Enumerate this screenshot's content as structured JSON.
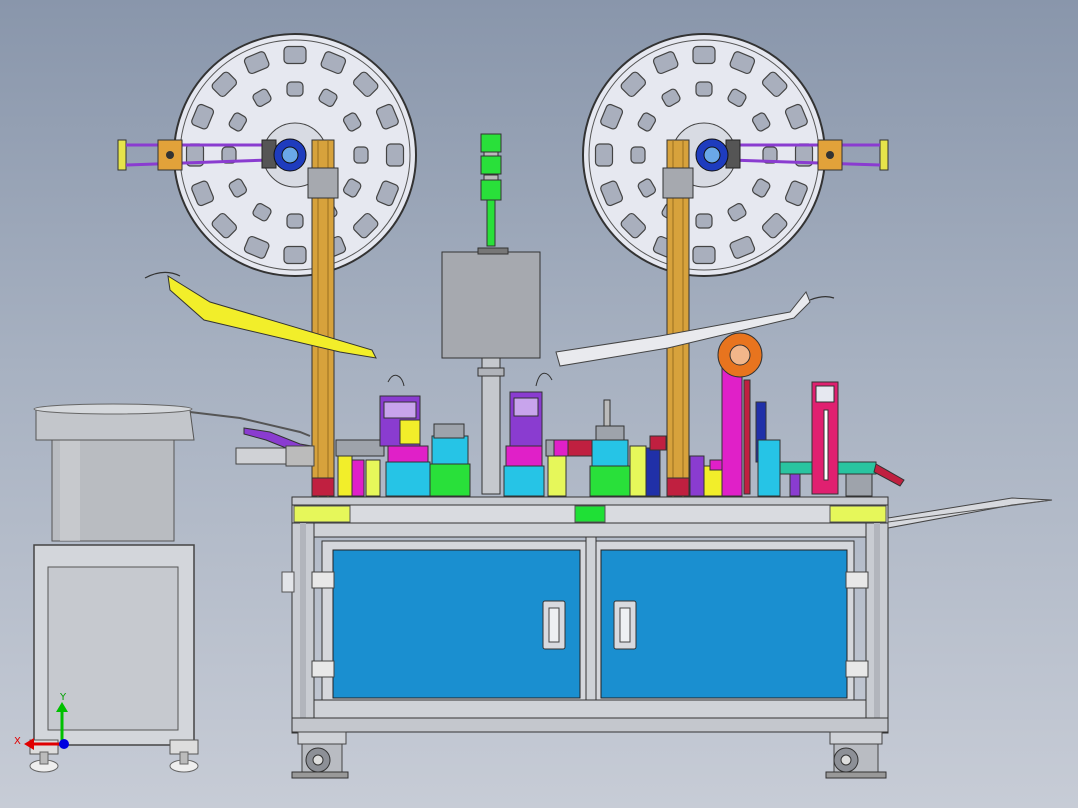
{
  "viewport": {
    "background_top": "#8996ab",
    "background_bottom": "#c7ccd6"
  },
  "triad": {
    "x_label": "X",
    "y_label": "Y",
    "x_color": "#e00000",
    "y_color": "#00c000",
    "z_color": "#0000e0"
  },
  "colors": {
    "frame": "#c9ccd2",
    "door": "#1a8fd0",
    "column": "#d7a23c",
    "reel": "#e6e8f0",
    "tower_green": "#29e03a",
    "magenta": "#e020c8",
    "yellow": "#f2ee2a",
    "purple": "#8a3cd0",
    "lime_panel": "#e6f75a"
  },
  "icons": {
    "left_reel": "reel-icon",
    "right_reel": "reel-icon",
    "signal_tower": "signal-tower-icon",
    "caster": "caster-wheel-icon"
  }
}
